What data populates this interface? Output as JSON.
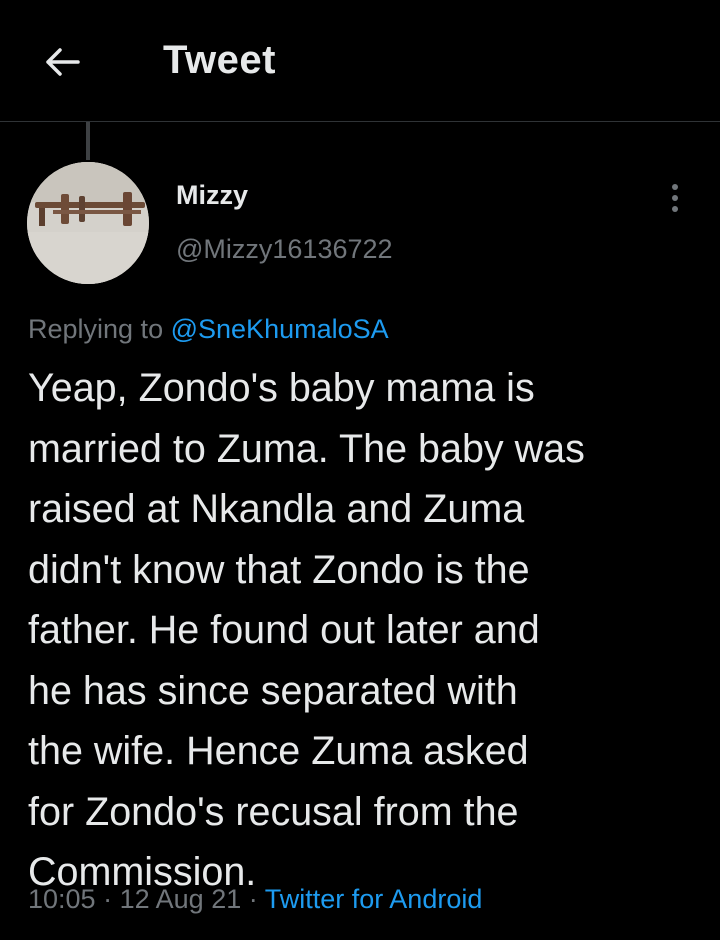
{
  "header": {
    "back_icon": "arrow-left-icon",
    "title": "Tweet"
  },
  "tweet": {
    "author": {
      "display_name": "Mizzy",
      "handle": "@Mizzy16136722",
      "avatar_icon": "avatar-photo"
    },
    "more_icon": "more-vertical-icon",
    "replying_to_label": "Replying to",
    "replying_to_handle": "@SneKhumaloSA",
    "text_lines": [
      "Yeap, Zondo's baby mama is",
      "married to Zuma. The baby was",
      "raised at Nkandla and Zuma",
      "didn't know that Zondo is the",
      "father. He found out later and",
      "he has since separated with",
      "the wife. Hence Zuma asked",
      "for Zondo's recusal from the",
      "Commission."
    ],
    "time": "10:05",
    "separator": "·",
    "date": "12 Aug 21",
    "source": "Twitter for Android"
  },
  "colors": {
    "background": "#000000",
    "text": "#e7e9ea",
    "secondary": "#71767b",
    "link": "#1d9bf0",
    "divider": "#2f3336"
  }
}
